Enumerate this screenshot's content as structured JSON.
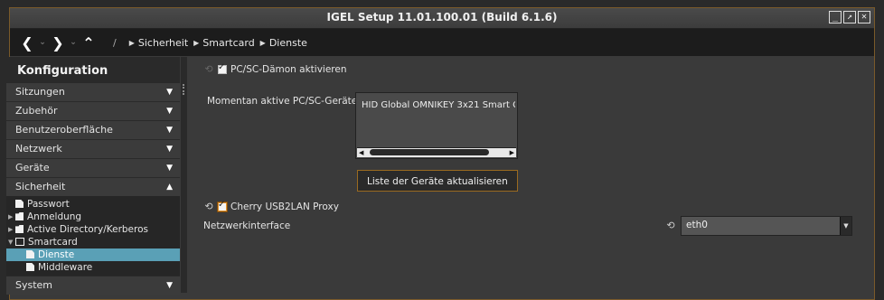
{
  "window": {
    "title": "IGEL Setup 11.01.100.01 (Build 6.1.6)",
    "controls": [
      "_",
      "↗",
      "✕"
    ]
  },
  "nav": {
    "back": "❮",
    "forward": "❯",
    "up": "⌃",
    "dropdown": "⌄",
    "crumb_sep": "/",
    "crumbs": [
      "Sicherheit",
      "Smartcard",
      "Dienste"
    ]
  },
  "sidebar": {
    "header": "Konfiguration",
    "categories": [
      {
        "label": "Sitzungen",
        "state": "▼"
      },
      {
        "label": "Zubehör",
        "state": "▼"
      },
      {
        "label": "Benutzeroberfläche",
        "state": "▼"
      },
      {
        "label": "Netzwerk",
        "state": "▼"
      },
      {
        "label": "Geräte",
        "state": "▼"
      },
      {
        "label": "Sicherheit",
        "state": "▲"
      }
    ],
    "tree": [
      "Passwort",
      "Anmeldung",
      "Active Directory/Kerberos",
      "Smartcard",
      "Dienste",
      "Middleware"
    ],
    "last_category": {
      "label": "System",
      "state": "▼"
    }
  },
  "content": {
    "pcsc_label": "PC/SC-Dämon aktivieren",
    "active_devices_label": "Momentan aktive PC/SC-Geräte:",
    "device_item": "HID Global OMNIKEY 3x21 Smart C",
    "refresh_button": "Liste der Geräte aktualisieren",
    "cherry_label": "Cherry USB2LAN Proxy",
    "netif_label": "Netzwerkinterface",
    "netif_value": "eth0"
  },
  "icons": {
    "reset": "⟲",
    "scroll_left": "◀",
    "scroll_right": "▶",
    "select_arrow": "▼"
  },
  "colors": {
    "accent_orange": "#e0912b",
    "selection_blue": "#5aa0b6"
  }
}
